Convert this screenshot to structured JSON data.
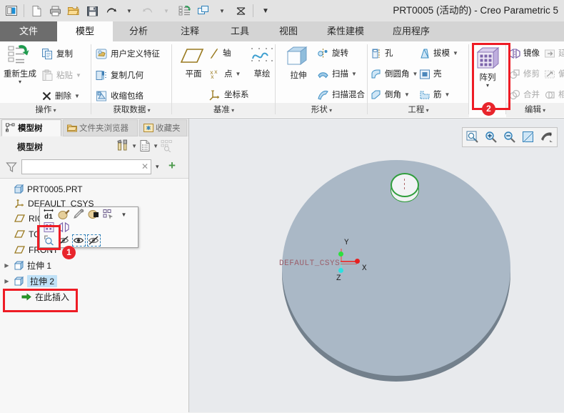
{
  "window": {
    "title": "PRT0005 (活动的) - Creo Parametric 5"
  },
  "quick_access": {
    "items": [
      {
        "name": "app-logo-icon",
        "label": "应用程序图标"
      },
      {
        "name": "new-icon",
        "label": "新建"
      },
      {
        "name": "print-icon",
        "label": "打印"
      },
      {
        "name": "open-icon",
        "label": "打开"
      },
      {
        "name": "save-icon",
        "label": "保存"
      },
      {
        "name": "undo-icon",
        "label": "撤消"
      },
      {
        "name": "undo-caret-icon",
        "label": "▾"
      },
      {
        "name": "redo-icon",
        "label": "重做"
      },
      {
        "name": "redo-caret-icon",
        "label": "▾"
      },
      {
        "name": "regenerate-icon",
        "label": "重新生成"
      },
      {
        "name": "window-icon",
        "label": "窗口"
      },
      {
        "name": "window-caret-icon",
        "label": "▾"
      },
      {
        "name": "close-window-icon",
        "label": "关闭窗口"
      },
      {
        "name": "qat-caret-icon",
        "label": "▾"
      }
    ]
  },
  "tabs": [
    {
      "label": "文件",
      "state": "file"
    },
    {
      "label": "模型",
      "state": "active"
    },
    {
      "label": "分析",
      "state": "normal"
    },
    {
      "label": "注释",
      "state": "normal"
    },
    {
      "label": "工具",
      "state": "normal"
    },
    {
      "label": "视图",
      "state": "normal"
    },
    {
      "label": "柔性建模",
      "state": "normal"
    },
    {
      "label": "应用程序",
      "state": "normal"
    }
  ],
  "ribbon": {
    "groups": [
      {
        "name": "operations",
        "label": "操作"
      },
      {
        "name": "get-data",
        "label": "获取数据"
      },
      {
        "name": "datum",
        "label": "基准"
      },
      {
        "name": "shapes",
        "label": "形状"
      },
      {
        "name": "engineering",
        "label": "工程"
      },
      {
        "name": "editing",
        "label": "编辑"
      }
    ],
    "operations": {
      "regenerate": "重新生成",
      "copy": "复制",
      "paste": "粘贴",
      "delete": "删除"
    },
    "get_data": {
      "udf": "用户定义特征",
      "copy_geom": "复制几何",
      "shrinkwrap": "收缩包络"
    },
    "datum": {
      "plane": "平面",
      "axis": "轴",
      "point": "点",
      "csys": "坐标系",
      "sketch": "草绘"
    },
    "shapes": {
      "extrude": "拉伸",
      "revolve": "旋转",
      "sweep": "扫描",
      "swept_blend": "扫描混合"
    },
    "engineering": {
      "hole": "孔",
      "draft": "拔模",
      "round": "倒圆角",
      "shell": "壳",
      "chamfer": "倒角",
      "rib": "筋"
    },
    "pattern": {
      "label": "阵列",
      "arrow": "▾"
    },
    "editing": {
      "mirror": "镜像",
      "extend": "延",
      "trim": "修剪",
      "offset": "偏",
      "merge": "合并",
      "intersect": "相"
    }
  },
  "left_panel": {
    "tabs": [
      {
        "label": "模型树",
        "icon": "model-tree-icon",
        "state": "active"
      },
      {
        "label": "文件夹浏览器",
        "icon": "folder-icon",
        "state": "inactive"
      },
      {
        "label": "收藏夹",
        "icon": "favorites-icon",
        "state": "inactive"
      }
    ],
    "header": {
      "title": "模型树",
      "settings_icon": "settings-tools-icon",
      "settings_caret": "▾",
      "display_icon": "display-list-icon",
      "display_caret": "▾",
      "filter_tree_icon": "tree-filter-icon"
    },
    "filter": {
      "icon": "funnel-icon",
      "value": "",
      "placeholder": "",
      "clear": "✕",
      "caret": "▾",
      "add": "+"
    },
    "tree": [
      {
        "label": "PRT0005.PRT",
        "icon": "part-icon",
        "level": 0,
        "expander": "",
        "selected": false
      },
      {
        "label": "DEFAULT_CSYS",
        "icon": "csys-icon",
        "level": 1,
        "expander": "",
        "selected": false
      },
      {
        "label": "RIGHT",
        "icon": "datum-plane-icon",
        "level": 1,
        "expander": "",
        "selected": false
      },
      {
        "label": "TOP",
        "icon": "datum-plane-icon",
        "level": 1,
        "expander": "",
        "selected": false
      },
      {
        "label": "FRONT",
        "icon": "datum-plane-icon",
        "level": 1,
        "expander": "",
        "selected": false
      },
      {
        "label": "拉伸 1",
        "icon": "extrude-feature-icon",
        "level": 1,
        "expander": "▶",
        "selected": false
      },
      {
        "label": "拉伸 2",
        "icon": "extrude-feature-icon",
        "level": 1,
        "expander": "▶",
        "selected": true
      },
      {
        "label": "在此插入",
        "icon": "insert-here-icon",
        "level": 2,
        "expander": "",
        "selected": false
      }
    ]
  },
  "mini_toolbar": {
    "rows": [
      [
        {
          "name": "dimension-icon",
          "label": "d1"
        },
        {
          "name": "appearance-paint-icon",
          "label": "外观"
        },
        {
          "name": "edit-definition-icon",
          "label": "编辑定义"
        },
        {
          "name": "color-icon",
          "label": "颜色"
        },
        {
          "name": "reference-icon",
          "label": "参考"
        },
        {
          "name": "more-caret-icon",
          "label": "▾"
        }
      ],
      [
        {
          "name": "pattern-icon",
          "label": "阵列"
        },
        {
          "name": "mirror-icon",
          "label": "镜像"
        }
      ],
      [
        {
          "name": "search-icon",
          "label": "搜索"
        },
        {
          "name": "hide-icon",
          "label": "隐藏"
        },
        {
          "name": "show-eye-icon",
          "label": "显示"
        },
        {
          "name": "hide-all-icon",
          "label": "全部隐藏"
        }
      ]
    ]
  },
  "graphics": {
    "toolbar": [
      {
        "name": "zoom-box-icon",
        "label": "放大区域"
      },
      {
        "name": "zoom-in-icon",
        "label": "放大"
      },
      {
        "name": "zoom-out-icon",
        "label": "缩小"
      },
      {
        "name": "refit-icon",
        "label": "重新调整"
      },
      {
        "name": "repaint-icon",
        "label": "重画"
      }
    ],
    "csys_label": "DEFAULT_CSYS",
    "axis_x": "X",
    "axis_y": "Y",
    "axis_z": "Z"
  },
  "annotations": [
    {
      "name": "callout-1",
      "badge": "1",
      "target": "mini-toolbar-pattern"
    },
    {
      "name": "callout-2",
      "badge": "2",
      "target": "ribbon-pattern"
    }
  ],
  "colors": {
    "accent_red": "#ee1c25",
    "badge_red": "#e8252c",
    "selection_blue": "#bfe1f7",
    "model_face": "#aab8c6",
    "model_side": "#73808c",
    "graphics_bg": "#e8eaed",
    "highlight_green": "#2f9e3c",
    "csys_text": "#9b5f6b"
  }
}
